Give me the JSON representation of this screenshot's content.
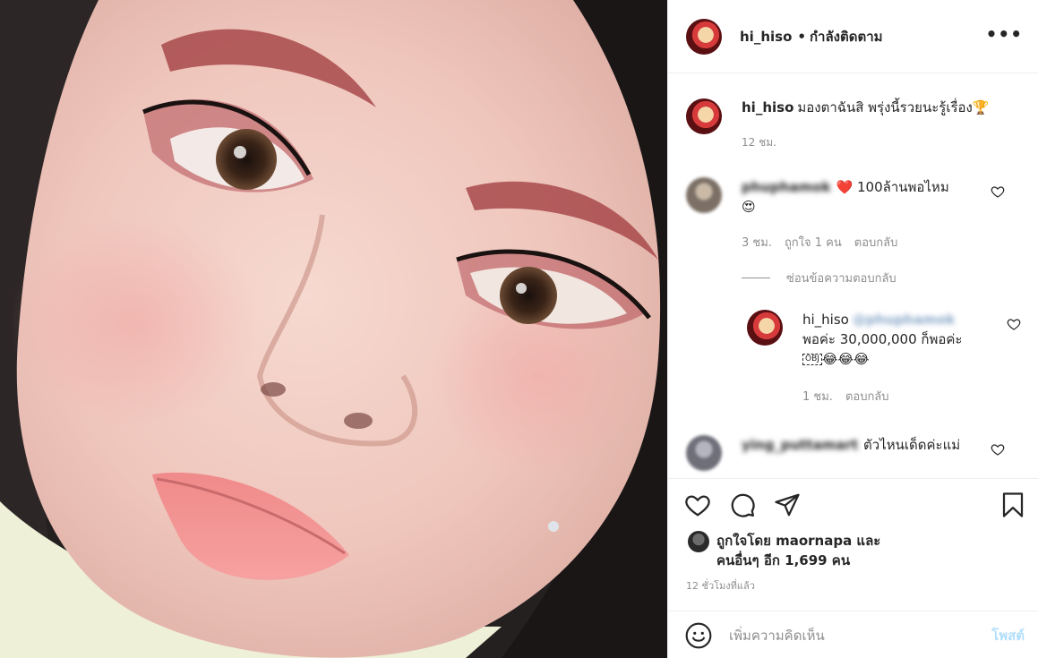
{
  "post": {
    "username": "hi_hiso",
    "dot": "•",
    "follow_status": "กำลังติดตาม",
    "more_label": "•••"
  },
  "caption": {
    "username": "hi_hiso",
    "text": "มองตาฉันสิ พรุ่งนี้รวยนะรู้เรื่อง🏆",
    "time": "12 ชม."
  },
  "comments": [
    {
      "username": "phuphamok",
      "text": "❤️ 100ล้านพอไหม",
      "text2": "😍",
      "time": "3 ชม.",
      "likes": "ถูกใจ 1 คน",
      "reply_label": "ตอบกลับ"
    },
    {
      "username": "ying_puttamart",
      "text": "ตัวไหนเด็ดค่ะแม่"
    }
  ],
  "hide_replies": "ซ่อนข้อความตอบกลับ",
  "reply": {
    "username": "hi_hiso",
    "mention": "@phuphamok",
    "text": "พอค่ะ 30,000,000 ก็พอค่ะ",
    "obj": "OBJ",
    "emojis": "😂😂😂",
    "time": "1 ชม.",
    "reply_label": "ตอบกลับ"
  },
  "likes": {
    "line1": "ถูกใจโดย maornapa และ",
    "line2": "คนอื่นๆ อีก 1,699 คน"
  },
  "timestamp": "12 ชั่วโมงที่แล้ว",
  "add_comment": {
    "placeholder": "เพิ่มความคิดเห็น",
    "post_label": "โพสต์"
  },
  "icons": {
    "like": "heart-icon",
    "comment": "comment-icon",
    "share": "share-icon",
    "save": "bookmark-icon",
    "emoji": "emoji-icon"
  },
  "colors": {
    "border": "#efefef",
    "muted": "#8e8e8e",
    "post_disabled": "#b2dffc",
    "heart_red": "#ed4956"
  }
}
